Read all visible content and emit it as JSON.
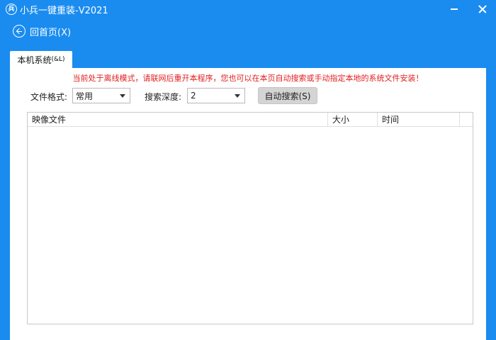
{
  "window": {
    "title": "小兵一键重装-V2021",
    "logo_glyph": "兵",
    "icons": {
      "minimize": "minimize-icon",
      "close": "close-icon"
    }
  },
  "backbar": {
    "label": "回首页(X)",
    "icon": "back-arrow-icon"
  },
  "tab": {
    "label": "本机系统",
    "shortcut": "(&L)"
  },
  "panel": {
    "notice": "当前处于离线模式，请联网后重开本程序，您也可以在本页自动搜索或手动指定本地的系统文件安装！",
    "file_format": {
      "label": "文件格式:",
      "value": "常用"
    },
    "search_depth": {
      "label": "搜索深度:",
      "value": "2"
    },
    "auto_search_label": "自动搜索(S)",
    "table": {
      "columns": [
        "映像文件",
        "大小",
        "时间"
      ],
      "rows": []
    }
  },
  "colors": {
    "accent": "#1a8cf0",
    "notice": "#e02020",
    "button": "#d4d4d4"
  }
}
